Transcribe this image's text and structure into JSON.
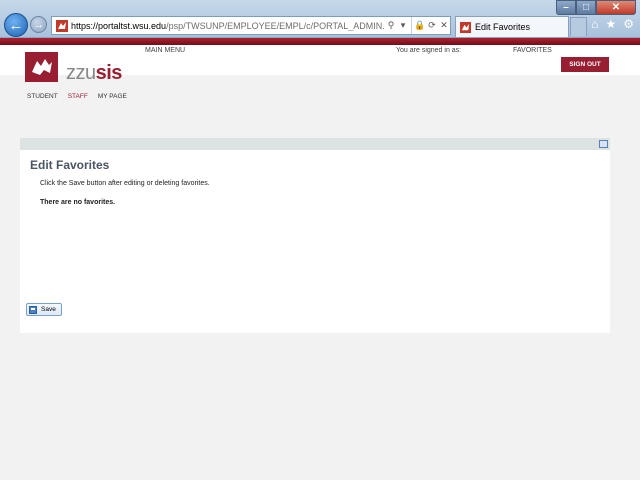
{
  "browser": {
    "url_host": "https://portaltst.wsu.edu",
    "url_path": "/psp/TWSUNP/EMPLOYEE/EMPL/c/PORTAL_ADMIN.PORTAL_EDIT_F",
    "tab_title": "Edit Favorites"
  },
  "header": {
    "brand_prefix": "zzu",
    "brand_suffix": "sis",
    "main_menu": "MAIN MENU",
    "signed_in": "You are signed in as:",
    "favorites": "FAVORITES",
    "sign_out": "SIGN OUT",
    "nav": [
      "STUDENT",
      "STAFF",
      "MY PAGE"
    ]
  },
  "content": {
    "title": "Edit Favorites",
    "instructions": "Click the Save button after editing or deleting favorites.",
    "empty_message": "There are no favorites.",
    "save_label": "Save"
  },
  "colors": {
    "brand": "#981e32",
    "title": "#4a5563"
  }
}
